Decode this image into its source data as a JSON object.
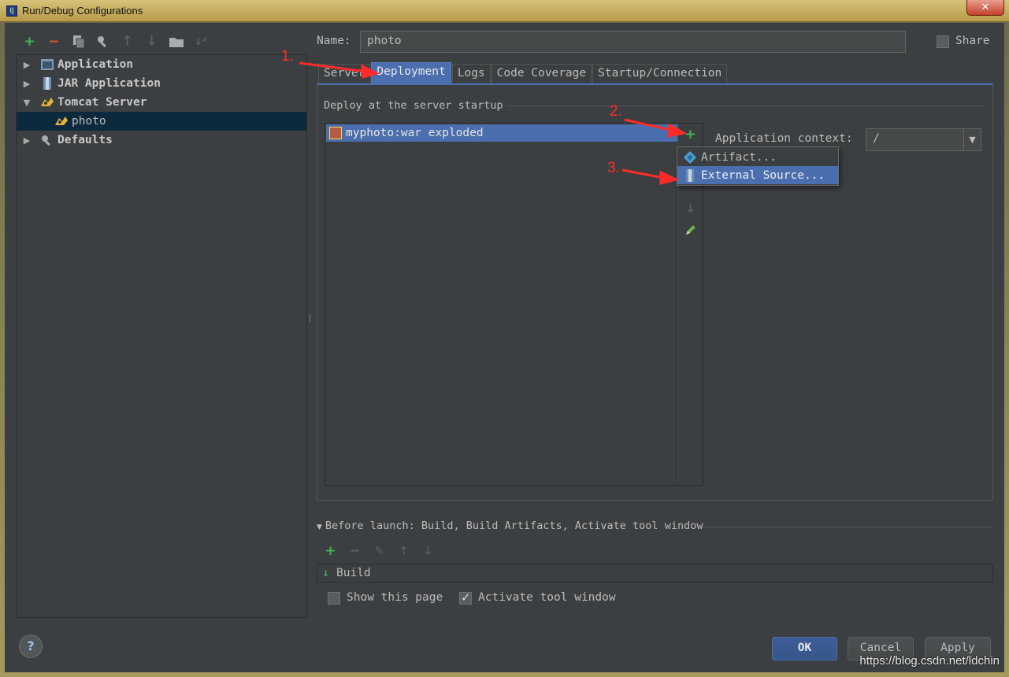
{
  "window": {
    "title": "Run/Debug Configurations",
    "close_glyph": "✕"
  },
  "left_toolbar": {
    "icons": [
      "add-icon",
      "remove-icon",
      "copy-icon",
      "edit-defaults-icon",
      "move-up-icon",
      "move-down-icon",
      "folder-icon",
      "sort-icon"
    ]
  },
  "tree": {
    "items": [
      {
        "label": "Application",
        "expanded": false,
        "icon": "application-icon"
      },
      {
        "label": "JAR Application",
        "expanded": false,
        "icon": "jar-icon"
      },
      {
        "label": "Tomcat Server",
        "expanded": true,
        "icon": "tomcat-icon"
      },
      {
        "label": "photo",
        "selected": true,
        "icon": "tomcat-icon"
      },
      {
        "label": "Defaults",
        "expanded": false,
        "icon": "wrench-icon"
      }
    ]
  },
  "name_field": {
    "label": "Name:",
    "value": "photo"
  },
  "share": {
    "label": "Share",
    "checked": false
  },
  "tabs": [
    {
      "label": "Server",
      "active": false
    },
    {
      "label": "Deployment",
      "active": true
    },
    {
      "label": "Logs",
      "active": false
    },
    {
      "label": "Code Coverage",
      "active": false
    },
    {
      "label": "Startup/Connection",
      "active": false
    }
  ],
  "deployment": {
    "section_title": "Deploy at the server startup",
    "artifacts": [
      "myphoto:war exploded"
    ],
    "context_label": "Application context:",
    "context_value": "/"
  },
  "add_popup": {
    "items": [
      {
        "label": "Artifact...",
        "icon": "artifact-icon",
        "highlighted": false
      },
      {
        "label": "External Source...",
        "icon": "external-source-icon",
        "highlighted": true
      }
    ]
  },
  "before_launch": {
    "title": "Before launch: Build, Build Artifacts, Activate tool window",
    "tasks": [
      "Build"
    ],
    "show_this_page": {
      "label": "Show this page",
      "checked": false
    },
    "activate_tool_window": {
      "label": "Activate tool window",
      "checked": true
    }
  },
  "buttons": {
    "help": "?",
    "ok": "OK",
    "cancel": "Cancel",
    "apply": "Apply"
  },
  "annotations": [
    "1.",
    "2.",
    "3."
  ],
  "watermark": "https://blog.csdn.net/ldchin",
  "colors": {
    "accent": "#4b6eaf",
    "background": "#3c3f41",
    "annotation": "#ff2a2a",
    "add_green": "#3fb34f",
    "remove_red": "#e0522c"
  }
}
